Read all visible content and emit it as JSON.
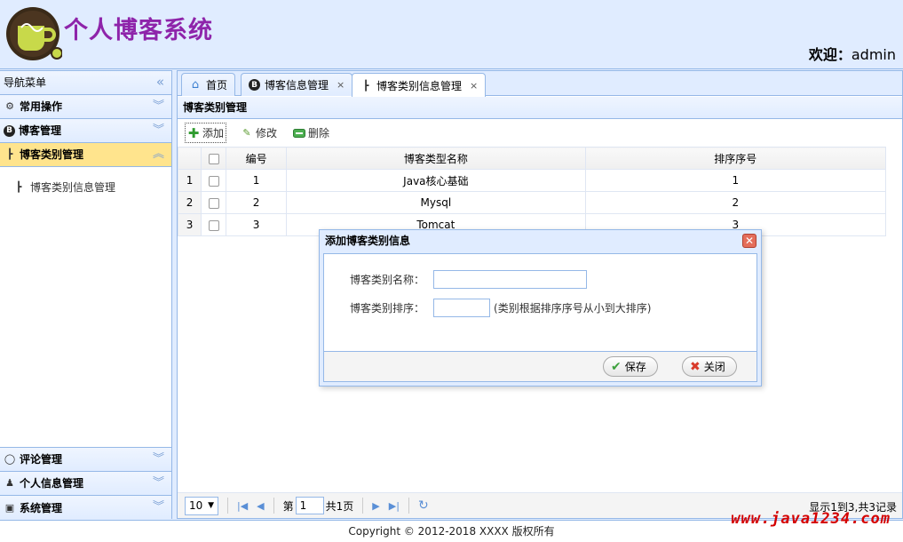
{
  "header": {
    "title": "个人博客系统",
    "welcome_prefix": "欢迎：",
    "username": "admin"
  },
  "sidebar": {
    "title": "导航菜单",
    "collapse_icon": "«",
    "sections": [
      {
        "label": "常用操作",
        "icon": "gear-icon"
      },
      {
        "label": "博客管理",
        "icon": "blog-icon"
      },
      {
        "label": "博客类别管理",
        "icon": "tree-icon"
      }
    ],
    "tree_item": "博客类别信息管理",
    "bottom_sections": [
      {
        "label": "评论管理",
        "icon": "comment-icon"
      },
      {
        "label": "个人信息管理",
        "icon": "user-icon"
      },
      {
        "label": "系统管理",
        "icon": "system-icon"
      }
    ]
  },
  "tabs": [
    {
      "label": "首页",
      "icon": "home-icon"
    },
    {
      "label": "博客信息管理",
      "icon": "blog-icon",
      "close": "×"
    },
    {
      "label": "博客类别信息管理",
      "icon": "tree-icon",
      "close": "×"
    }
  ],
  "panel": {
    "title": "博客类别管理"
  },
  "toolbar": {
    "add": "添加",
    "edit": "修改",
    "delete": "删除"
  },
  "grid": {
    "columns": [
      "编号",
      "博客类型名称",
      "排序序号"
    ],
    "rows": [
      {
        "rn": "1",
        "id": "1",
        "name": "Java核心基础",
        "order": "1"
      },
      {
        "rn": "2",
        "id": "2",
        "name": "Mysql",
        "order": "2"
      },
      {
        "rn": "3",
        "id": "3",
        "name": "Tomcat",
        "order": "3"
      }
    ]
  },
  "pager": {
    "page_size": "10",
    "page_prefix": "第",
    "page": "1",
    "page_suffix": "共1页",
    "info": "显示1到3,共3记录"
  },
  "dialog": {
    "title": "添加博客类别信息",
    "name_label": "博客类别名称：",
    "order_label": "博客类别排序：",
    "hint": "(类别根据排序序号从小到大排序)",
    "save": "保存",
    "close": "关闭"
  },
  "footer": {
    "copyright": "Copyright © 2012-2018 XXXX 版权所有"
  },
  "watermark": "www.java1234.com",
  "colors": {
    "accent": "#95b8e7",
    "header_bg": "#e0ecff",
    "selected": "#ffe48d",
    "title": "#8e24aa"
  }
}
